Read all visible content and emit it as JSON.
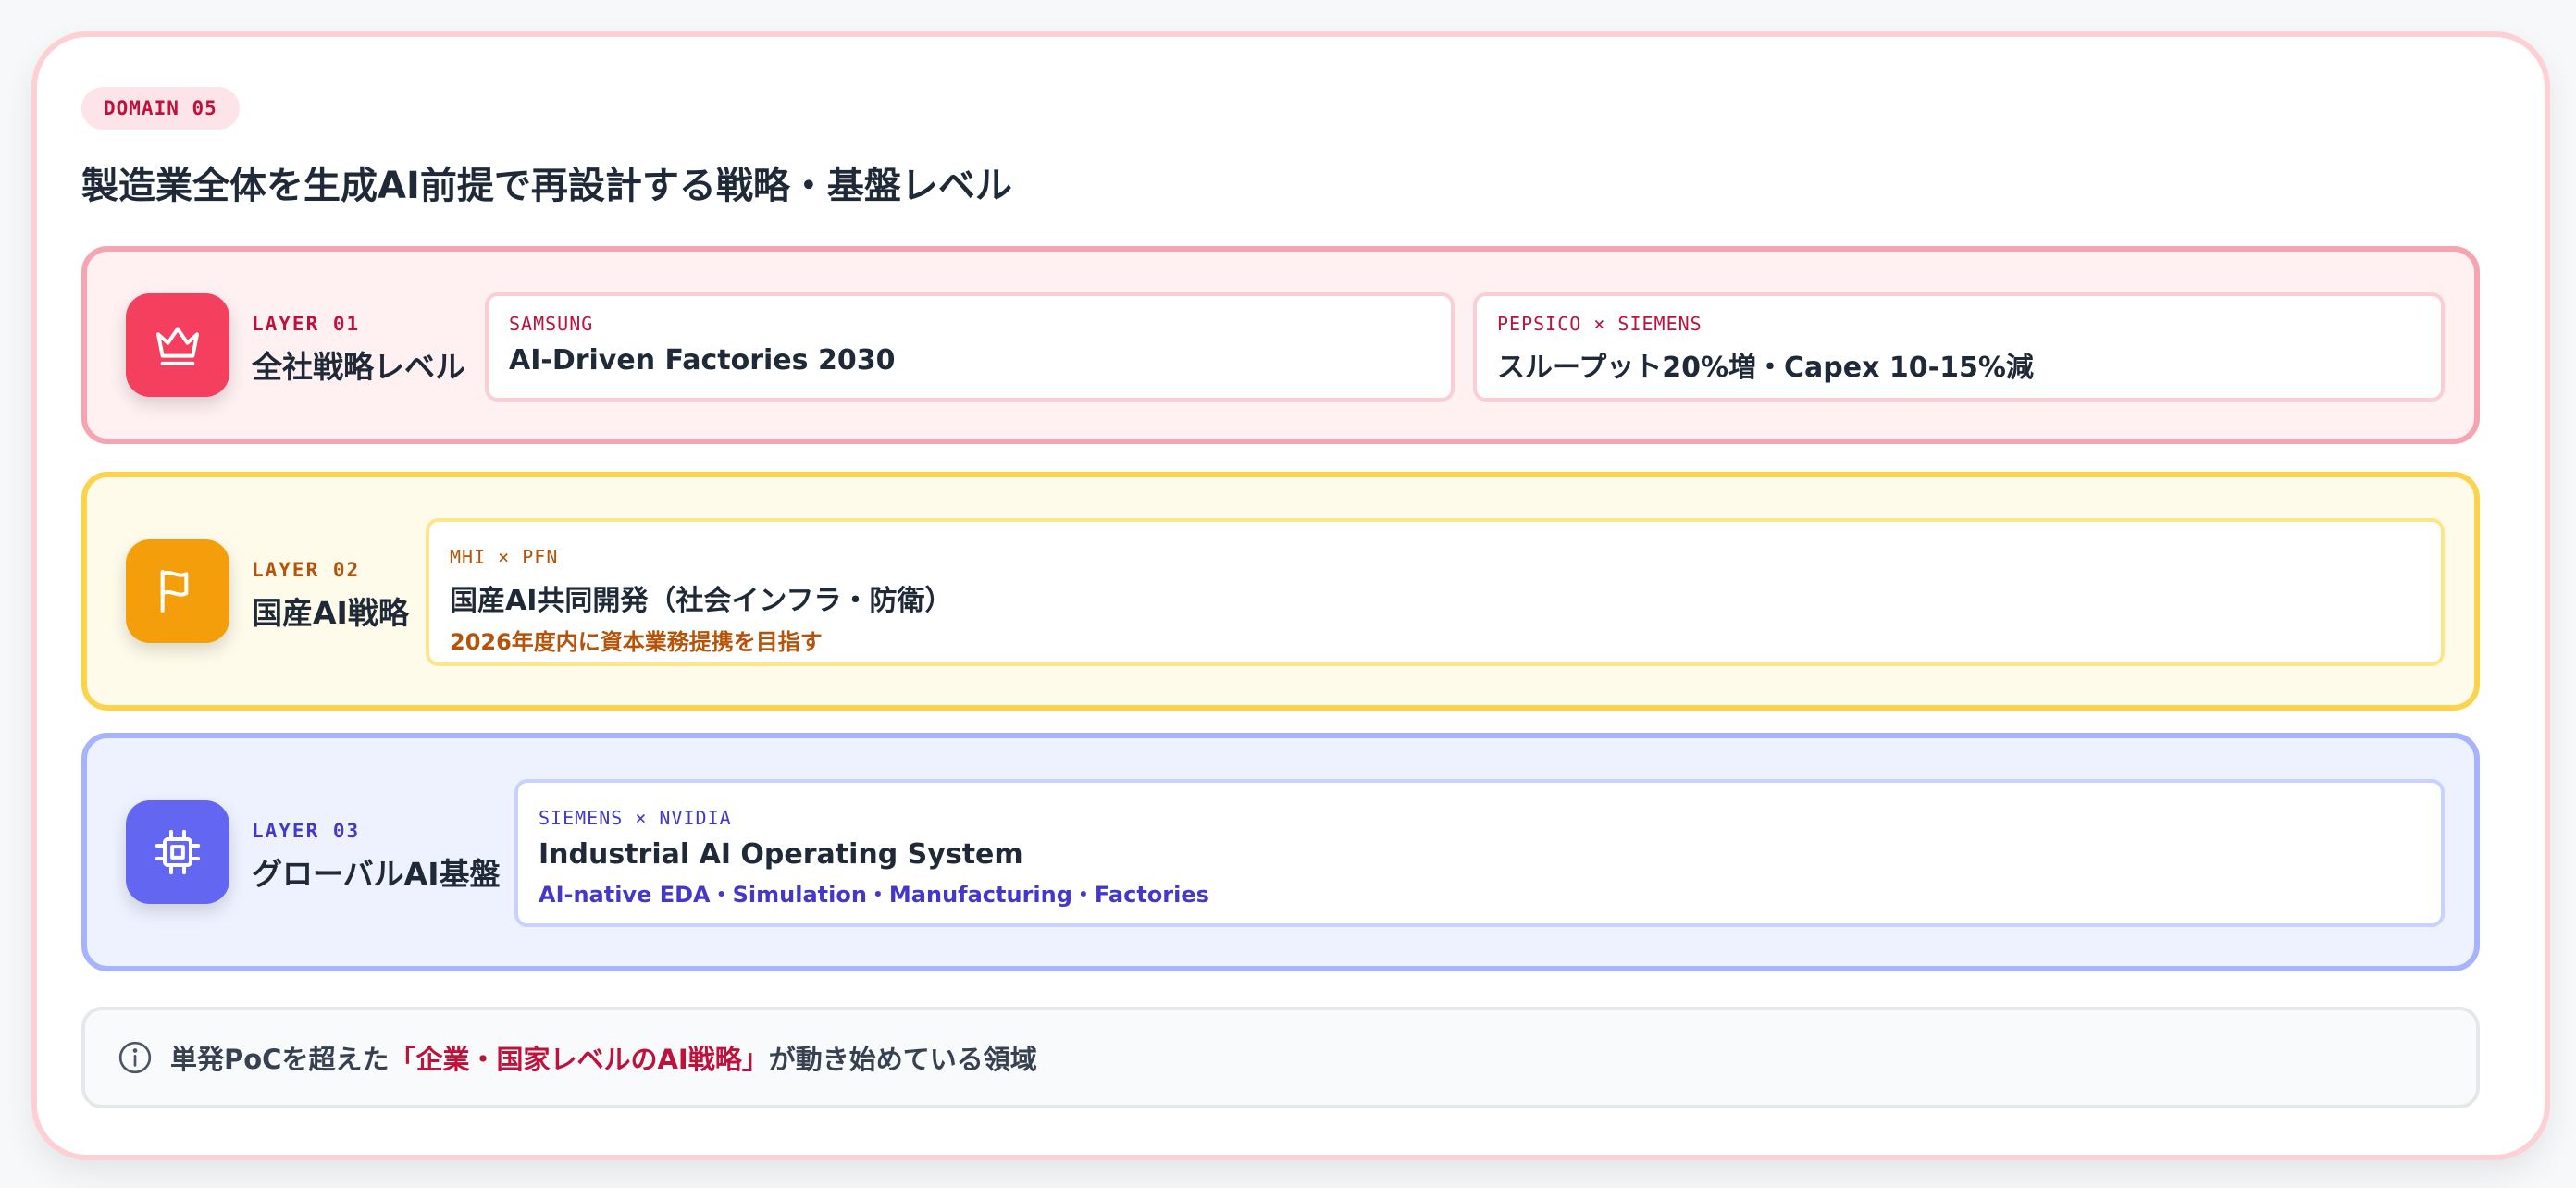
{
  "domain_badge": "DOMAIN 05",
  "title": "製造業全体を生成AI前提で再設計する戦略・基盤レベル",
  "colors": {
    "layer1_accent": "#f43f5e",
    "layer2_accent": "#f59e0b",
    "layer3_accent": "#6366f1",
    "highlight": "#be123c"
  },
  "layers": [
    {
      "tag": "LAYER 01",
      "name": "全社戦略レベル",
      "icon": "crown-icon",
      "tiles": [
        {
          "tag": "SAMSUNG",
          "title": "AI-Driven Factories 2030"
        },
        {
          "tag": "PEPSICO × SIEMENS",
          "title": "スループット20%増・Capex 10-15%減"
        }
      ]
    },
    {
      "tag": "LAYER 02",
      "name": "国産AI戦略",
      "icon": "flag-icon",
      "tiles": [
        {
          "tag": "MHI × PFN",
          "title": "国産AI共同開発（社会インフラ・防衛）",
          "subtitle": "2026年度内に資本業務提携を目指す"
        }
      ]
    },
    {
      "tag": "LAYER 03",
      "name": "グローバルAI基盤",
      "icon": "cpu-chip-icon",
      "tiles": [
        {
          "tag": "SIEMENS × NVIDIA",
          "title": "Industrial AI Operating System",
          "subtitle": "AI-native EDA・Simulation・Manufacturing・Factories"
        }
      ]
    }
  ],
  "note": {
    "icon": "info-icon",
    "prefix": "単発PoCを超えた",
    "highlight": "「企業・国家レベルのAI戦略」",
    "suffix": "が動き始めている領域"
  }
}
